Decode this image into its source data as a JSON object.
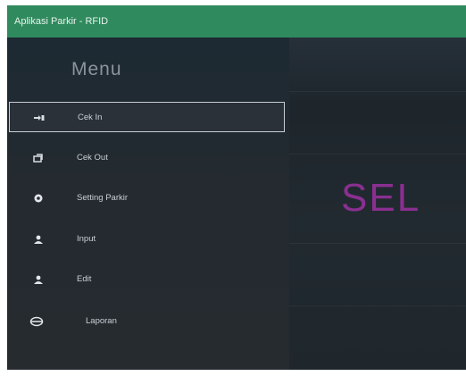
{
  "window": {
    "title": "Aplikasi Parkir - RFID"
  },
  "sidebar": {
    "heading": "Menu",
    "items": [
      {
        "label": "Cek In",
        "icon": "sign-in-icon",
        "active": true
      },
      {
        "label": "Cek Out",
        "icon": "sign-out-icon",
        "active": false
      },
      {
        "label": "Setting Parkir",
        "icon": "gear-icon",
        "active": false
      },
      {
        "label": "Input",
        "icon": "user-add-icon",
        "active": false
      },
      {
        "label": "Edit",
        "icon": "user-edit-icon",
        "active": false
      },
      {
        "label": "Laporan",
        "icon": "report-icon",
        "active": false
      }
    ]
  },
  "main": {
    "banner_text": "SEL"
  },
  "colors": {
    "titlebar": "#2f8a5e",
    "sidebar": "#242a30",
    "content": "#222a31",
    "banner": "#8a2f91"
  }
}
